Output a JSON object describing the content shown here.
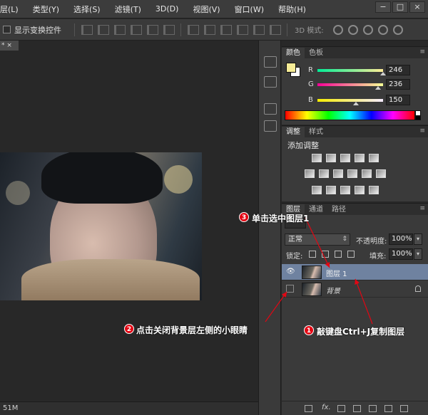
{
  "menu": [
    "层(L)",
    "类型(Y)",
    "选择(S)",
    "滤镜(T)",
    "3D(D)",
    "视图(V)",
    "窗口(W)",
    "帮助(H)"
  ],
  "window_controls": [
    "−",
    "□",
    "×"
  ],
  "options_bar": {
    "show_transform_label": "显示变换控件",
    "mode_3d_label": "3D 模式:"
  },
  "doc_tab": {
    "label": "* ×"
  },
  "status_bar": {
    "text": "51M"
  },
  "color_panel": {
    "tabs": [
      "颜色",
      "色板"
    ],
    "fg_color": "#f6ec96",
    "channels": [
      {
        "label": "R",
        "value": "246"
      },
      {
        "label": "G",
        "value": "236"
      },
      {
        "label": "B",
        "value": "150"
      }
    ]
  },
  "adjust_panel": {
    "tabs": [
      "调整",
      "样式"
    ],
    "title": "添加调整"
  },
  "layers_panel": {
    "tabs": [
      "图层",
      "通道",
      "路径"
    ],
    "blend_mode": "正常",
    "opacity_label": "不透明度:",
    "opacity_value": "100%",
    "lock_label": "锁定:",
    "fill_label": "填充:",
    "fill_value": "100%",
    "layers": [
      {
        "name": "图层 1",
        "visible": true,
        "selected": true
      },
      {
        "name": "背景",
        "visible": false,
        "selected": false
      }
    ],
    "footer_fx": "fx."
  },
  "annotations": [
    {
      "number": "1",
      "text": "敲键盘Ctrl+J复制图层"
    },
    {
      "number": "2",
      "text": "点击关闭背景层左侧的小眼睛"
    },
    {
      "number": "3",
      "text": "单击选中图层1"
    }
  ],
  "accent_color": "#e30613"
}
